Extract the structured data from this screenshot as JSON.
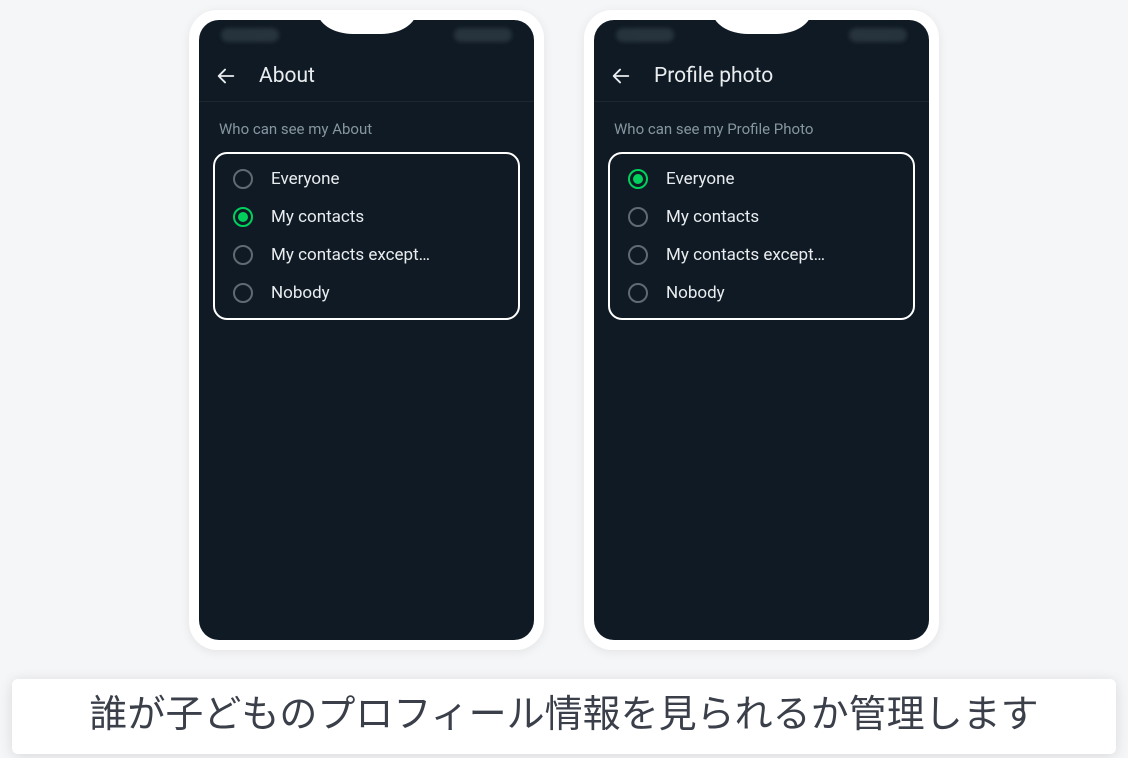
{
  "phones": [
    {
      "title": "About",
      "section_label": "Who can see my About",
      "options": [
        {
          "label": "Everyone",
          "selected": false
        },
        {
          "label": "My contacts",
          "selected": true
        },
        {
          "label": "My contacts except…",
          "selected": false
        },
        {
          "label": "Nobody",
          "selected": false
        }
      ]
    },
    {
      "title": "Profile photo",
      "section_label": "Who can see my Profile Photo",
      "options": [
        {
          "label": "Everyone",
          "selected": true
        },
        {
          "label": "My contacts",
          "selected": false
        },
        {
          "label": "My contacts except…",
          "selected": false
        },
        {
          "label": "Nobody",
          "selected": false
        }
      ]
    }
  ],
  "caption": "誰が子どものプロフィール情報を見られるか管理します",
  "colors": {
    "accent": "#00d15c",
    "screen_bg": "#0f1a24"
  }
}
